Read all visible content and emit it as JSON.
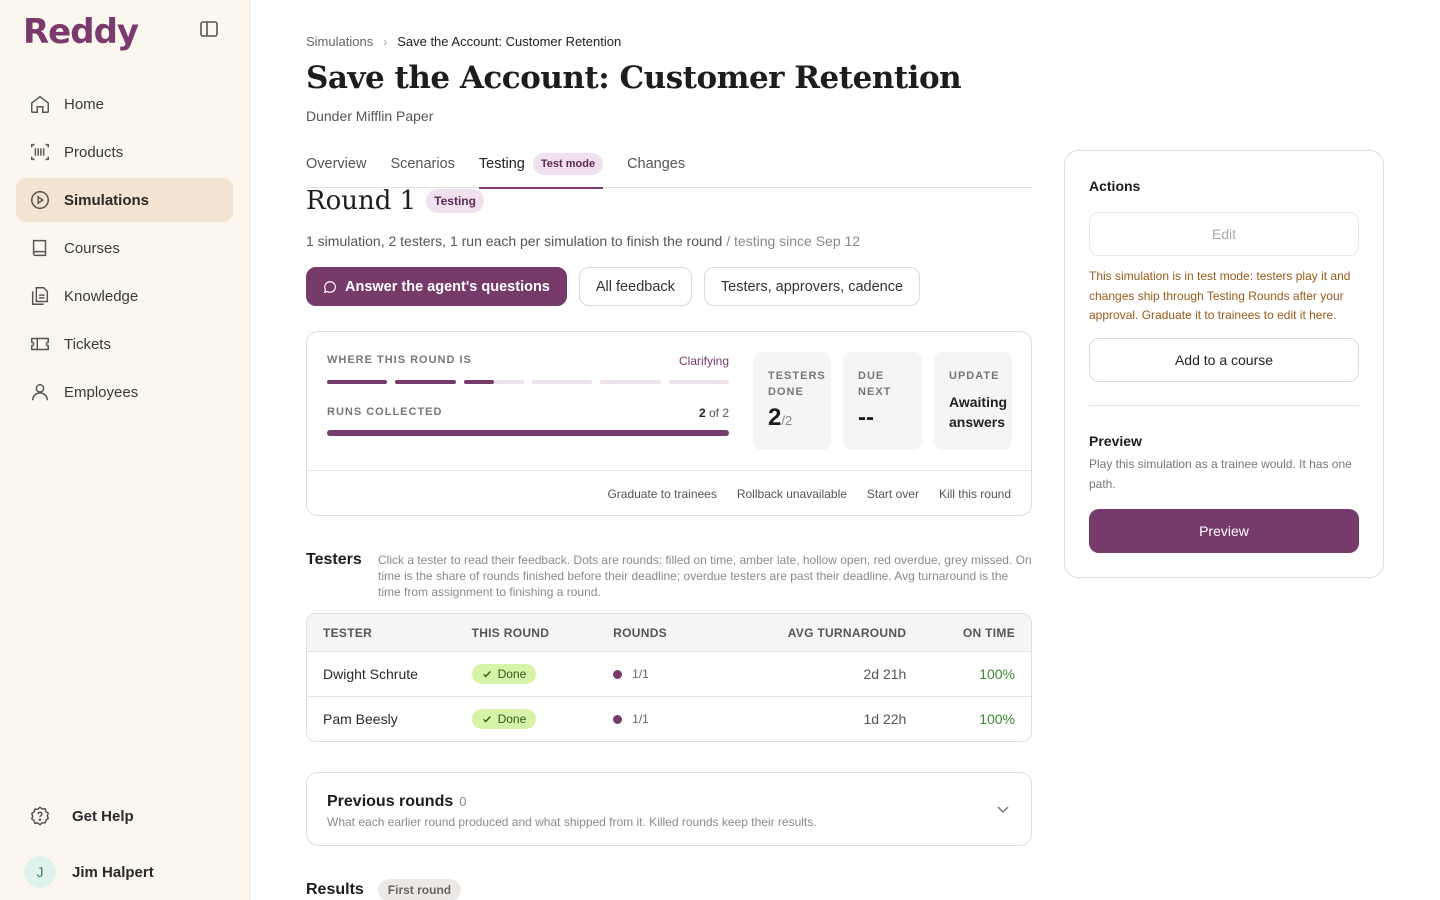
{
  "app": {
    "logo": "Reddy"
  },
  "sidebar": {
    "items": [
      {
        "label": "Home",
        "icon": "home-icon"
      },
      {
        "label": "Products",
        "icon": "barcode-icon"
      },
      {
        "label": "Simulations",
        "icon": "play-circle-icon",
        "active": true
      },
      {
        "label": "Courses",
        "icon": "book-icon"
      },
      {
        "label": "Knowledge",
        "icon": "documents-icon"
      },
      {
        "label": "Tickets",
        "icon": "ticket-icon"
      },
      {
        "label": "Employees",
        "icon": "user-icon"
      }
    ],
    "help_label": "Get Help",
    "user": {
      "initial": "J",
      "name": "Jim Halpert"
    }
  },
  "breadcrumb": {
    "parent": "Simulations",
    "current": "Save the Account: Customer Retention"
  },
  "page": {
    "title": "Save the Account: Customer Retention",
    "subtitle": "Dunder Mifflin Paper"
  },
  "tabs": [
    {
      "label": "Overview"
    },
    {
      "label": "Scenarios"
    },
    {
      "label": "Testing",
      "badge": "Test mode",
      "active": true
    },
    {
      "label": "Changes"
    }
  ],
  "round": {
    "title": "Round 1",
    "badge": "Testing",
    "description": "1 simulation, 2 testers, 1 run each per simulation to finish the round",
    "since": " / testing since Sep 12"
  },
  "actions_row": {
    "primary": "Answer the agent's questions",
    "feedback": "All feedback",
    "settings": "Testers, approvers, cadence"
  },
  "status": {
    "where_label": "WHERE THIS ROUND IS",
    "stage": "Clarifying",
    "stage_progress": {
      "segments_total": 6,
      "segments_complete": 2,
      "current_segment_fill": 0.5
    },
    "runs_label": "RUNS COLLECTED",
    "runs_done": "2",
    "runs_of": " of 2",
    "runs_fraction": 1.0,
    "testers_label_1": "TESTERS",
    "testers_label_2": "DONE",
    "testers_done": "2",
    "testers_total": "/2",
    "due_label_1": "DUE",
    "due_label_2": "NEXT",
    "due_value": "--",
    "update_label": "UPDATE",
    "update_line1": "Awaiting",
    "update_line2": "answers",
    "footer": [
      "Graduate to trainees",
      "Rollback unavailable",
      "Start over",
      "Kill this round"
    ]
  },
  "testers": {
    "heading": "Testers",
    "note": "Click a tester to read their feedback. Dots are rounds: filled on time, amber late, hollow open, red overdue, grey missed. On time is the share of rounds finished before their deadline; overdue testers are past their deadline. Avg turnaround is the time from assignment to finishing a round.",
    "columns": [
      "TESTER",
      "THIS ROUND",
      "ROUNDS",
      "AVG TURNAROUND",
      "ON TIME"
    ],
    "rows": [
      {
        "name": "Dwight Schrute",
        "status": "Done",
        "rounds": "1/1",
        "turnaround": "2d 21h",
        "on_time": "100%"
      },
      {
        "name": "Pam Beesly",
        "status": "Done",
        "rounds": "1/1",
        "turnaround": "1d 22h",
        "on_time": "100%"
      }
    ]
  },
  "previous_rounds": {
    "title": "Previous rounds",
    "count": "0",
    "description": "What each earlier round produced and what shipped from it. Killed rounds keep their results."
  },
  "results": {
    "title": "Results",
    "badge": "First round"
  },
  "panel": {
    "heading": "Actions",
    "edit_label": "Edit",
    "test_note": "This simulation is in test mode: testers play it and changes ship through Testing Rounds after your approval. Graduate it to trainees to edit it here.",
    "course_label": "Add to a course",
    "preview_heading": "Preview",
    "preview_desc": "Play this simulation as a trainee would. It has one path.",
    "preview_label": "Preview"
  },
  "colors": {
    "brand": "#763a6b",
    "sidebar_bg": "#fbf6ee",
    "active_nav": "#f3e3d1",
    "done_green": "#d7f3a8",
    "warning_text": "#9a5a1a"
  }
}
